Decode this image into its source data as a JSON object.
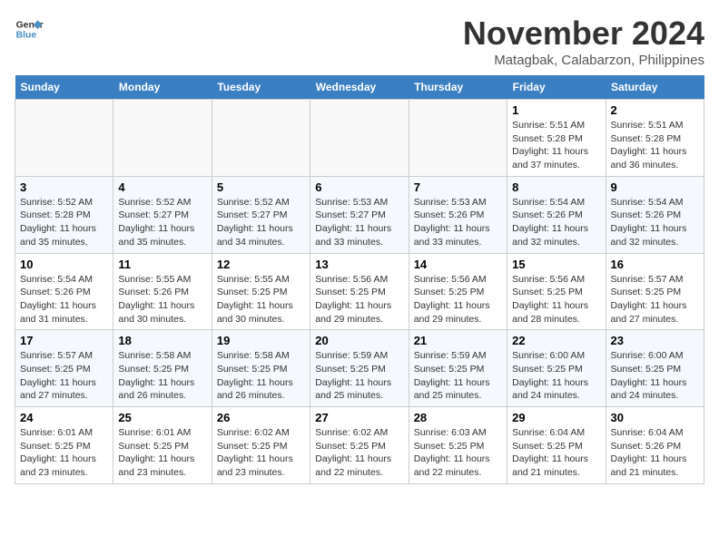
{
  "header": {
    "logo_line1": "General",
    "logo_line2": "Blue",
    "month_title": "November 2024",
    "location": "Matagbak, Calabarzon, Philippines"
  },
  "weekdays": [
    "Sunday",
    "Monday",
    "Tuesday",
    "Wednesday",
    "Thursday",
    "Friday",
    "Saturday"
  ],
  "weeks": [
    [
      {
        "day": "",
        "empty": true
      },
      {
        "day": "",
        "empty": true
      },
      {
        "day": "",
        "empty": true
      },
      {
        "day": "",
        "empty": true
      },
      {
        "day": "",
        "empty": true
      },
      {
        "day": "1",
        "sunrise": "Sunrise: 5:51 AM",
        "sunset": "Sunset: 5:28 PM",
        "daylight": "Daylight: 11 hours and 37 minutes."
      },
      {
        "day": "2",
        "sunrise": "Sunrise: 5:51 AM",
        "sunset": "Sunset: 5:28 PM",
        "daylight": "Daylight: 11 hours and 36 minutes."
      }
    ],
    [
      {
        "day": "3",
        "sunrise": "Sunrise: 5:52 AM",
        "sunset": "Sunset: 5:28 PM",
        "daylight": "Daylight: 11 hours and 35 minutes."
      },
      {
        "day": "4",
        "sunrise": "Sunrise: 5:52 AM",
        "sunset": "Sunset: 5:27 PM",
        "daylight": "Daylight: 11 hours and 35 minutes."
      },
      {
        "day": "5",
        "sunrise": "Sunrise: 5:52 AM",
        "sunset": "Sunset: 5:27 PM",
        "daylight": "Daylight: 11 hours and 34 minutes."
      },
      {
        "day": "6",
        "sunrise": "Sunrise: 5:53 AM",
        "sunset": "Sunset: 5:27 PM",
        "daylight": "Daylight: 11 hours and 33 minutes."
      },
      {
        "day": "7",
        "sunrise": "Sunrise: 5:53 AM",
        "sunset": "Sunset: 5:26 PM",
        "daylight": "Daylight: 11 hours and 33 minutes."
      },
      {
        "day": "8",
        "sunrise": "Sunrise: 5:54 AM",
        "sunset": "Sunset: 5:26 PM",
        "daylight": "Daylight: 11 hours and 32 minutes."
      },
      {
        "day": "9",
        "sunrise": "Sunrise: 5:54 AM",
        "sunset": "Sunset: 5:26 PM",
        "daylight": "Daylight: 11 hours and 32 minutes."
      }
    ],
    [
      {
        "day": "10",
        "sunrise": "Sunrise: 5:54 AM",
        "sunset": "Sunset: 5:26 PM",
        "daylight": "Daylight: 11 hours and 31 minutes."
      },
      {
        "day": "11",
        "sunrise": "Sunrise: 5:55 AM",
        "sunset": "Sunset: 5:26 PM",
        "daylight": "Daylight: 11 hours and 30 minutes."
      },
      {
        "day": "12",
        "sunrise": "Sunrise: 5:55 AM",
        "sunset": "Sunset: 5:25 PM",
        "daylight": "Daylight: 11 hours and 30 minutes."
      },
      {
        "day": "13",
        "sunrise": "Sunrise: 5:56 AM",
        "sunset": "Sunset: 5:25 PM",
        "daylight": "Daylight: 11 hours and 29 minutes."
      },
      {
        "day": "14",
        "sunrise": "Sunrise: 5:56 AM",
        "sunset": "Sunset: 5:25 PM",
        "daylight": "Daylight: 11 hours and 29 minutes."
      },
      {
        "day": "15",
        "sunrise": "Sunrise: 5:56 AM",
        "sunset": "Sunset: 5:25 PM",
        "daylight": "Daylight: 11 hours and 28 minutes."
      },
      {
        "day": "16",
        "sunrise": "Sunrise: 5:57 AM",
        "sunset": "Sunset: 5:25 PM",
        "daylight": "Daylight: 11 hours and 27 minutes."
      }
    ],
    [
      {
        "day": "17",
        "sunrise": "Sunrise: 5:57 AM",
        "sunset": "Sunset: 5:25 PM",
        "daylight": "Daylight: 11 hours and 27 minutes."
      },
      {
        "day": "18",
        "sunrise": "Sunrise: 5:58 AM",
        "sunset": "Sunset: 5:25 PM",
        "daylight": "Daylight: 11 hours and 26 minutes."
      },
      {
        "day": "19",
        "sunrise": "Sunrise: 5:58 AM",
        "sunset": "Sunset: 5:25 PM",
        "daylight": "Daylight: 11 hours and 26 minutes."
      },
      {
        "day": "20",
        "sunrise": "Sunrise: 5:59 AM",
        "sunset": "Sunset: 5:25 PM",
        "daylight": "Daylight: 11 hours and 25 minutes."
      },
      {
        "day": "21",
        "sunrise": "Sunrise: 5:59 AM",
        "sunset": "Sunset: 5:25 PM",
        "daylight": "Daylight: 11 hours and 25 minutes."
      },
      {
        "day": "22",
        "sunrise": "Sunrise: 6:00 AM",
        "sunset": "Sunset: 5:25 PM",
        "daylight": "Daylight: 11 hours and 24 minutes."
      },
      {
        "day": "23",
        "sunrise": "Sunrise: 6:00 AM",
        "sunset": "Sunset: 5:25 PM",
        "daylight": "Daylight: 11 hours and 24 minutes."
      }
    ],
    [
      {
        "day": "24",
        "sunrise": "Sunrise: 6:01 AM",
        "sunset": "Sunset: 5:25 PM",
        "daylight": "Daylight: 11 hours and 23 minutes."
      },
      {
        "day": "25",
        "sunrise": "Sunrise: 6:01 AM",
        "sunset": "Sunset: 5:25 PM",
        "daylight": "Daylight: 11 hours and 23 minutes."
      },
      {
        "day": "26",
        "sunrise": "Sunrise: 6:02 AM",
        "sunset": "Sunset: 5:25 PM",
        "daylight": "Daylight: 11 hours and 23 minutes."
      },
      {
        "day": "27",
        "sunrise": "Sunrise: 6:02 AM",
        "sunset": "Sunset: 5:25 PM",
        "daylight": "Daylight: 11 hours and 22 minutes."
      },
      {
        "day": "28",
        "sunrise": "Sunrise: 6:03 AM",
        "sunset": "Sunset: 5:25 PM",
        "daylight": "Daylight: 11 hours and 22 minutes."
      },
      {
        "day": "29",
        "sunrise": "Sunrise: 6:04 AM",
        "sunset": "Sunset: 5:25 PM",
        "daylight": "Daylight: 11 hours and 21 minutes."
      },
      {
        "day": "30",
        "sunrise": "Sunrise: 6:04 AM",
        "sunset": "Sunset: 5:26 PM",
        "daylight": "Daylight: 11 hours and 21 minutes."
      }
    ]
  ]
}
